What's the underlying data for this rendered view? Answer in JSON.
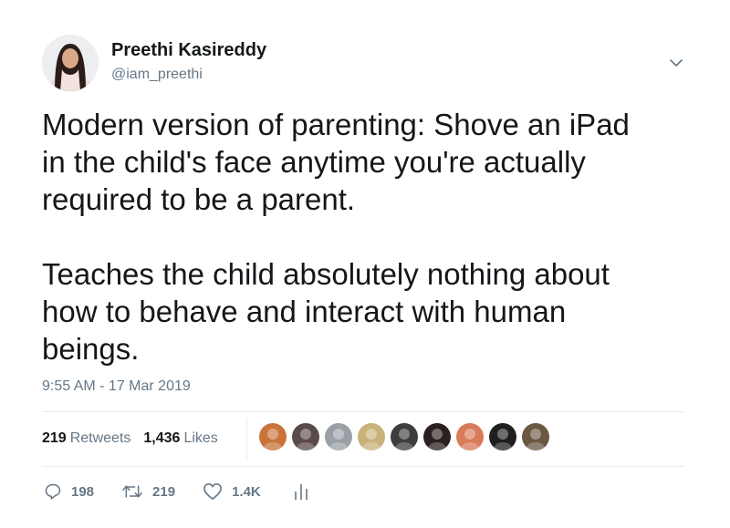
{
  "user": {
    "name": "Preethi Kasireddy",
    "handle": "@iam_preethi"
  },
  "tweet": {
    "text": "Modern version of parenting: Shove an iPad\nin the child's face anytime you're actually\nrequired to be a parent.\n\nTeaches the child absolutely nothing about\nhow to behave and interact with human\nbeings.",
    "timestamp": "9:55 AM - 17 Mar 2019"
  },
  "stats": {
    "retweets_count": "219",
    "retweets_label": "Retweets",
    "likes_count": "1,436",
    "likes_label": "Likes"
  },
  "liker_avatars": [
    {
      "color": "#c9733a"
    },
    {
      "color": "#5a4a4a"
    },
    {
      "color": "#9aa0a6"
    },
    {
      "color": "#c8b27a"
    },
    {
      "color": "#3d3d3d"
    },
    {
      "color": "#2a2020"
    },
    {
      "color": "#d97a5a"
    },
    {
      "color": "#1f1f1f"
    },
    {
      "color": "#6b5842"
    }
  ],
  "actions": {
    "reply_count": "198",
    "retweet_count": "219",
    "like_count": "1.4K"
  },
  "icons": {
    "caret": "chevron-down-icon",
    "reply": "reply-icon",
    "retweet": "retweet-icon",
    "like": "heart-icon",
    "analytics": "analytics-icon"
  },
  "colors": {
    "text": "#14171a",
    "secondary": "#657786",
    "divider": "#e6ecf0"
  }
}
